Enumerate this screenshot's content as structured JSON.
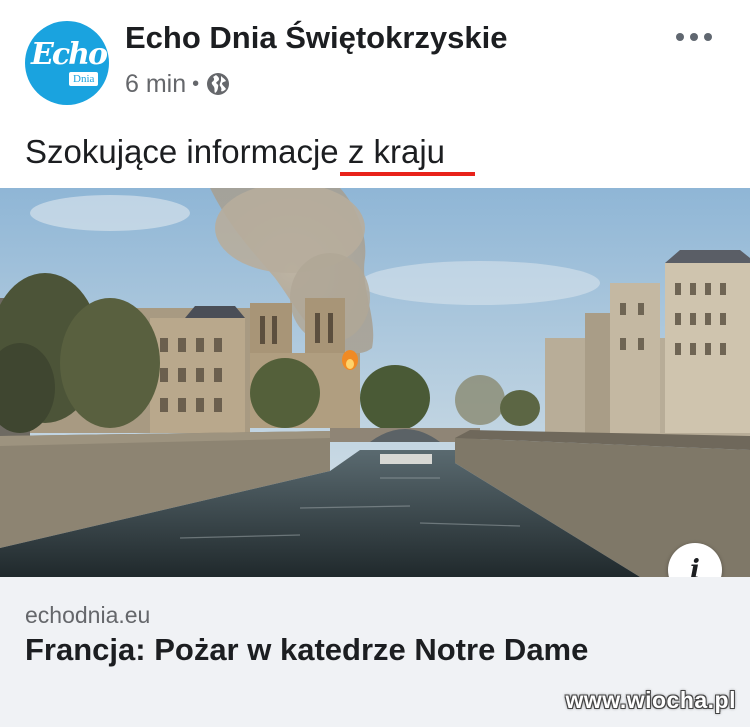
{
  "post": {
    "page_name": "Echo Dnia Świętokrzyskie",
    "avatar_text": "Echo",
    "avatar_subtext": "Dnia",
    "time": "6 min",
    "separator": "•",
    "privacy_icon": "globe-icon",
    "more_icon": "more-horizontal-icon",
    "text": "Szokujące informacje z kraju"
  },
  "link_preview": {
    "domain": "echodnia.eu",
    "title": "Francja: Pożar w katedrze Notre Dame",
    "info_label": "i"
  },
  "watermark": "www.wiocha.pl",
  "colors": {
    "avatar_bg": "#1aa3df",
    "underline": "#e8221a",
    "meta_text": "#65676b",
    "link_bg": "#f0f2f5"
  }
}
